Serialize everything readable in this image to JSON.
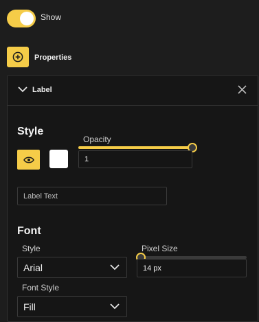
{
  "visibility": {
    "show_label": "Show",
    "on": true
  },
  "properties": {
    "label": "Properties"
  },
  "panel": {
    "title": "Label",
    "style_heading": "Style",
    "opacity": {
      "label": "Opacity",
      "value": "1",
      "level": 1.0
    },
    "label_text": {
      "placeholder": "Label Text"
    },
    "font_heading": "Font",
    "style": {
      "label": "Style",
      "value": "Arial"
    },
    "pixel_size": {
      "label": "Pixel Size",
      "value": "14 px",
      "level": 0.0
    },
    "font_style": {
      "label": "Font Style",
      "value": "Fill"
    }
  },
  "colors": {
    "accent": "#f5cc48",
    "background": "#1d1d1d",
    "panel": "#161616",
    "swatch": "#ffffff"
  },
  "icons": {
    "add": "plus-circle-icon",
    "collapse": "chevron-down-icon",
    "close": "close-icon",
    "visibility": "eye-icon"
  }
}
